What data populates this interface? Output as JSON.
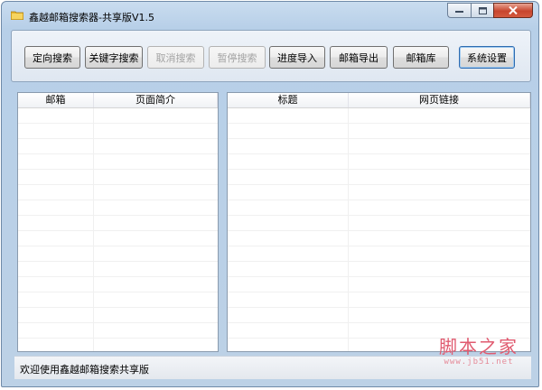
{
  "window": {
    "title": "鑫越邮箱搜索器-共享版V1.5"
  },
  "toolbar": {
    "buttons": [
      {
        "label": "定向搜索",
        "enabled": true
      },
      {
        "label": "关键字搜索",
        "enabled": true
      },
      {
        "label": "取消搜索",
        "enabled": false
      },
      {
        "label": "暂停搜索",
        "enabled": false
      },
      {
        "label": "进度导入",
        "enabled": true
      },
      {
        "label": "邮箱导出",
        "enabled": true
      },
      {
        "label": "邮箱库",
        "enabled": true
      },
      {
        "label": "系统设置",
        "enabled": true,
        "focused": true
      }
    ]
  },
  "left_list": {
    "columns": [
      "邮箱",
      "页面简介"
    ]
  },
  "right_list": {
    "columns": [
      "标题",
      "网页链接"
    ]
  },
  "status": {
    "text": "欢迎使用鑫越邮箱搜索共享版"
  },
  "watermark": {
    "main": "脚本之家",
    "sub": "www.jb51.net"
  },
  "colors": {
    "close_button": "#c7452d",
    "focus_border": "#2d6bb0",
    "watermark": "#e05a6f"
  }
}
